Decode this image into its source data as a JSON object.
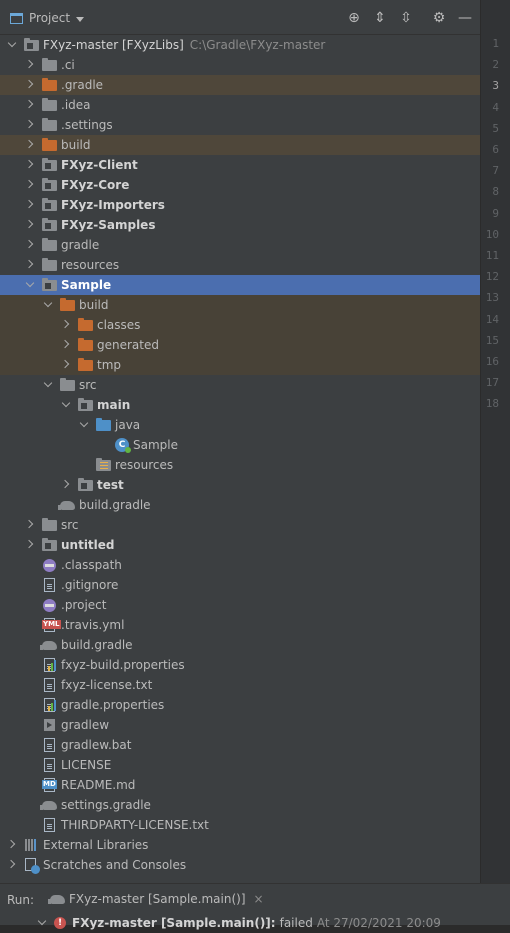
{
  "header": {
    "title": "Project"
  },
  "tree": [
    {
      "depth": 0,
      "arrow": "d",
      "icon": "module",
      "label": "FXyz-master [FXyzLibs]",
      "bold": false,
      "path": "C:\\Gradle\\FXyz-master"
    },
    {
      "depth": 1,
      "arrow": "r",
      "icon": "folder",
      "label": ".ci"
    },
    {
      "depth": 1,
      "arrow": "r",
      "icon": "folder-orange",
      "label": ".gradle",
      "bg": "excl"
    },
    {
      "depth": 1,
      "arrow": "r",
      "icon": "folder",
      "label": ".idea"
    },
    {
      "depth": 1,
      "arrow": "r",
      "icon": "folder",
      "label": ".settings"
    },
    {
      "depth": 1,
      "arrow": "r",
      "icon": "folder-orange",
      "label": "build",
      "bg": "excl"
    },
    {
      "depth": 1,
      "arrow": "r",
      "icon": "module",
      "label": "FXyz-Client",
      "bold": true
    },
    {
      "depth": 1,
      "arrow": "r",
      "icon": "module",
      "label": "FXyz-Core",
      "bold": true
    },
    {
      "depth": 1,
      "arrow": "r",
      "icon": "module",
      "label": "FXyz-Importers",
      "bold": true
    },
    {
      "depth": 1,
      "arrow": "r",
      "icon": "module",
      "label": "FXyz-Samples",
      "bold": true
    },
    {
      "depth": 1,
      "arrow": "r",
      "icon": "folder",
      "label": "gradle"
    },
    {
      "depth": 1,
      "arrow": "r",
      "icon": "folder",
      "label": "resources"
    },
    {
      "depth": 1,
      "arrow": "d",
      "icon": "module",
      "label": "Sample",
      "bold": true,
      "bg": "sel"
    },
    {
      "depth": 2,
      "arrow": "d",
      "icon": "folder-orange",
      "label": "build",
      "bg": "excl2"
    },
    {
      "depth": 3,
      "arrow": "r",
      "icon": "folder-orange",
      "label": "classes",
      "bg": "excl2"
    },
    {
      "depth": 3,
      "arrow": "r",
      "icon": "folder-orange",
      "label": "generated",
      "bg": "excl2"
    },
    {
      "depth": 3,
      "arrow": "r",
      "icon": "folder-orange",
      "label": "tmp",
      "bg": "excl2"
    },
    {
      "depth": 2,
      "arrow": "d",
      "icon": "folder",
      "label": "src"
    },
    {
      "depth": 3,
      "arrow": "d",
      "icon": "module",
      "label": "main",
      "bold": true
    },
    {
      "depth": 4,
      "arrow": "d",
      "icon": "folder-blue",
      "label": "java"
    },
    {
      "depth": 5,
      "arrow": "",
      "icon": "class",
      "label": "Sample"
    },
    {
      "depth": 4,
      "arrow": "",
      "icon": "folder-res",
      "label": "resources"
    },
    {
      "depth": 3,
      "arrow": "r",
      "icon": "module",
      "label": "test",
      "bold": true
    },
    {
      "depth": 2,
      "arrow": "",
      "icon": "gradle",
      "label": "build.gradle"
    },
    {
      "depth": 1,
      "arrow": "r",
      "icon": "folder",
      "label": "src"
    },
    {
      "depth": 1,
      "arrow": "r",
      "icon": "module",
      "label": "untitled",
      "bold": true
    },
    {
      "depth": 1,
      "arrow": "",
      "icon": "gear-file",
      "label": ".classpath"
    },
    {
      "depth": 1,
      "arrow": "",
      "icon": "file",
      "label": ".gitignore"
    },
    {
      "depth": 1,
      "arrow": "",
      "icon": "gear-file",
      "label": ".project"
    },
    {
      "depth": 1,
      "arrow": "",
      "icon": "yml",
      "label": ".travis.yml"
    },
    {
      "depth": 1,
      "arrow": "",
      "icon": "gradle",
      "label": "build.gradle"
    },
    {
      "depth": 1,
      "arrow": "",
      "icon": "props",
      "label": "fxyz-build.properties"
    },
    {
      "depth": 1,
      "arrow": "",
      "icon": "file",
      "label": "fxyz-license.txt"
    },
    {
      "depth": 1,
      "arrow": "",
      "icon": "props",
      "label": "gradle.properties"
    },
    {
      "depth": 1,
      "arrow": "",
      "icon": "term",
      "label": "gradlew"
    },
    {
      "depth": 1,
      "arrow": "",
      "icon": "file",
      "label": "gradlew.bat"
    },
    {
      "depth": 1,
      "arrow": "",
      "icon": "file",
      "label": "LICENSE"
    },
    {
      "depth": 1,
      "arrow": "",
      "icon": "md",
      "label": "README.md"
    },
    {
      "depth": 1,
      "arrow": "",
      "icon": "gradle",
      "label": "settings.gradle"
    },
    {
      "depth": 1,
      "arrow": "",
      "icon": "file",
      "label": "THIRDPARTY-LICENSE.txt"
    },
    {
      "depth": 0,
      "arrow": "r",
      "icon": "lib",
      "label": "External Libraries"
    },
    {
      "depth": 0,
      "arrow": "r",
      "icon": "scratch",
      "label": "Scratches and Consoles"
    }
  ],
  "gutter": {
    "lines": [
      "1",
      "2",
      "3",
      "4",
      "5",
      "6",
      "7",
      "8",
      "9",
      "10",
      "11",
      "12",
      "13",
      "14",
      "15",
      "16",
      "17",
      "18"
    ],
    "current": "3"
  },
  "run": {
    "label": "Run:",
    "tab": "FXyz-master [Sample.main()]",
    "close": "×",
    "status_title": "FXyz-master [Sample.main()]:",
    "status_text": "failed",
    "status_time": "At 27/02/2021 20:09"
  },
  "icons": {
    "locate": "⊕",
    "expand": "⇕",
    "collapse": "⇳",
    "settings": "⚙",
    "hide": "—",
    "error": "!"
  }
}
